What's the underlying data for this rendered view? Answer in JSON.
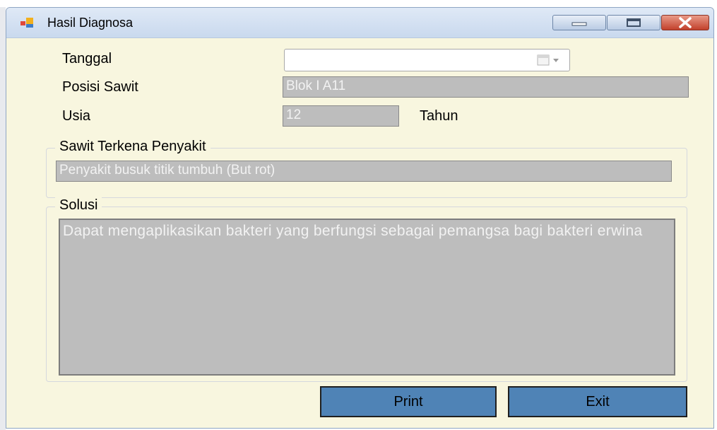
{
  "window": {
    "title": "Hasil Diagnosa",
    "icon": "app-window-icon",
    "controls": [
      "minimize-icon",
      "maximize-icon",
      "close-icon"
    ]
  },
  "form": {
    "tanggal_label": "Tanggal",
    "tanggal_value": "",
    "posisi_label": "Posisi Sawit",
    "posisi_value": "Blok I A11",
    "usia_label": "Usia",
    "usia_value": "12",
    "usia_unit": "Tahun"
  },
  "penyakit_group": {
    "title": "Sawit Terkena Penyakit",
    "value": "Penyakit busuk titik tumbuh (But rot)"
  },
  "solusi_group": {
    "title": "Solusi",
    "value": "Dapat mengaplikasikan bakteri yang berfungsi sebagai pemangsa bagi bakteri erwina"
  },
  "buttons": {
    "print_label": "Print",
    "exit_label": "Exit"
  },
  "colors": {
    "form_background": "#f8f6df",
    "field_disabled": "#bdbdbd",
    "button_fill": "#4f83b6"
  }
}
